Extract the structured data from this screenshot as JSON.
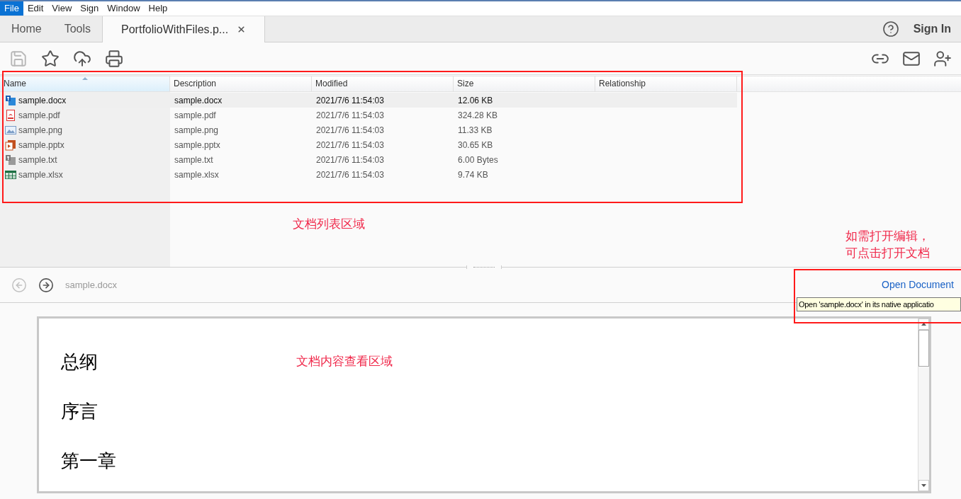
{
  "menu": [
    {
      "label": "File",
      "selected": true
    },
    {
      "label": "Edit",
      "selected": false
    },
    {
      "label": "View",
      "selected": false
    },
    {
      "label": "Sign",
      "selected": false
    },
    {
      "label": "Window",
      "selected": false
    },
    {
      "label": "Help",
      "selected": false
    }
  ],
  "tabs": [
    {
      "label": "Home",
      "selected": false,
      "closable": false
    },
    {
      "label": "Tools",
      "selected": false,
      "closable": false
    },
    {
      "label": "PortfolioWithFiles.p...",
      "selected": true,
      "closable": true
    }
  ],
  "sign_in": "Sign In",
  "toolbar_left": [
    {
      "kind": "save",
      "disabled": true
    },
    {
      "kind": "star",
      "disabled": false
    },
    {
      "kind": "upload",
      "disabled": false
    },
    {
      "kind": "print",
      "disabled": false
    }
  ],
  "toolbar_right": [
    {
      "kind": "share-link",
      "disabled": false
    },
    {
      "kind": "mail",
      "disabled": false
    },
    {
      "kind": "add-user",
      "disabled": false
    }
  ],
  "file_list": {
    "columns": [
      {
        "label": "Name",
        "sorted": true
      },
      {
        "label": "Description",
        "sorted": false
      },
      {
        "label": "Modified",
        "sorted": false
      },
      {
        "label": "Size",
        "sorted": false
      },
      {
        "label": "Relationship",
        "sorted": false
      }
    ],
    "rows": [
      {
        "kind": "docx",
        "name": "sample.docx",
        "description": "sample.docx",
        "modified": "2021/7/6 11:54:03",
        "size": "12.06 KB",
        "selected": true
      },
      {
        "kind": "pdf",
        "name": "sample.pdf",
        "description": "sample.pdf",
        "modified": "2021/7/6 11:54:03",
        "size": "324.28 KB",
        "selected": false
      },
      {
        "kind": "png",
        "name": "sample.png",
        "description": "sample.png",
        "modified": "2021/7/6 11:54:03",
        "size": "11.33 KB",
        "selected": false
      },
      {
        "kind": "pptx",
        "name": "sample.pptx",
        "description": "sample.pptx",
        "modified": "2021/7/6 11:54:03",
        "size": "30.65 KB",
        "selected": false
      },
      {
        "kind": "txt",
        "name": "sample.txt",
        "description": "sample.txt",
        "modified": "2021/7/6 11:54:03",
        "size": "6.00 Bytes",
        "selected": false
      },
      {
        "kind": "xlsx",
        "name": "sample.xlsx",
        "description": "sample.xlsx",
        "modified": "2021/7/6 11:54:03",
        "size": "9.74 KB",
        "selected": false
      }
    ]
  },
  "nav": {
    "back_disabled": true,
    "forward_disabled": false,
    "current": "sample.docx",
    "open_document": "Open Document",
    "tooltip": "Open 'sample.docx' in its native applicatio"
  },
  "document": {
    "headings": [
      "总纲",
      "序言",
      "第一章"
    ]
  },
  "annotations": {
    "list_area": "文档列表区域",
    "open_hint": [
      "如需打开编辑，",
      "可点击打开文档"
    ],
    "content_area": "文档内容查看区域"
  }
}
